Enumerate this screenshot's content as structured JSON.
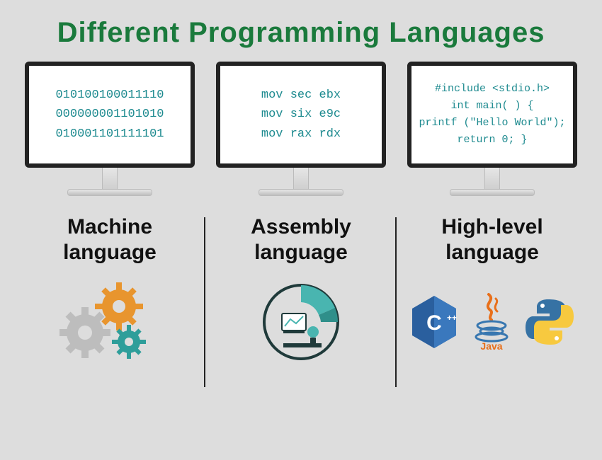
{
  "title": "Different Programming Languages",
  "columns": [
    {
      "label_line1": "Machine",
      "label_line2": "language",
      "code": [
        "010100100011110",
        "000000001101010",
        "010001101111101"
      ],
      "icon": "gears"
    },
    {
      "label_line1": "Assembly",
      "label_line2": "language",
      "code": [
        "mov sec ebx",
        "mov six e9c",
        "mov rax rdx"
      ],
      "icon": "dashboard-chart"
    },
    {
      "label_line1": "High-level",
      "label_line2": "language",
      "code": [
        "#include <stdio.h>",
        "int main( ) {",
        "printf (\"Hello World\");",
        "return 0; }"
      ],
      "icon": "language-logos",
      "logos": {
        "cpp": "C++",
        "java": "Java",
        "python": "Python"
      }
    }
  ]
}
